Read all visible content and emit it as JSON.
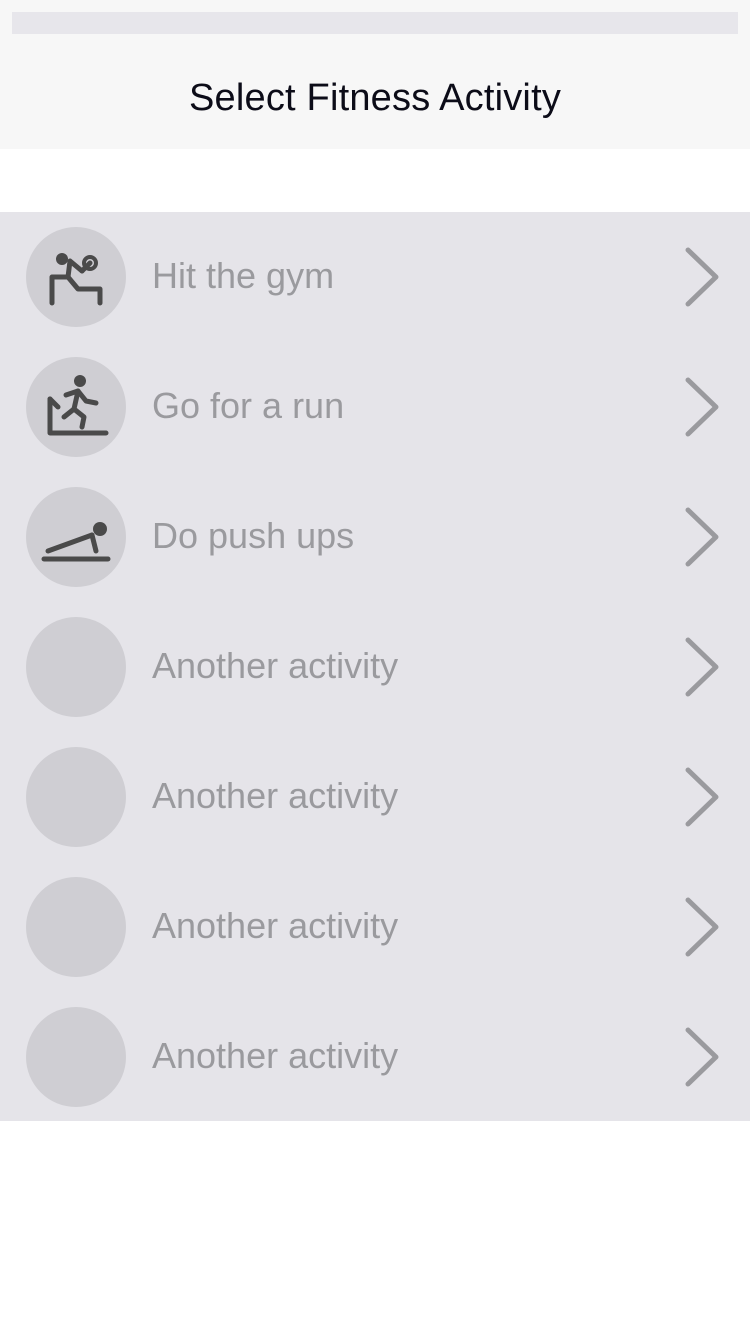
{
  "header": {
    "title": "Select Fitness Activity"
  },
  "colors": {
    "nav_background": "#f7f7f7",
    "list_background": "#e5e4e9",
    "icon_circle": "#cfced3",
    "icon_glyph": "#4a4a4a",
    "label_text": "#9a9a9e",
    "chevron": "#9a9a9e"
  },
  "activities": [
    {
      "label": "Hit the gym",
      "icon": "weightlifting-icon"
    },
    {
      "label": "Go for a run",
      "icon": "treadmill-runner-icon"
    },
    {
      "label": "Do push ups",
      "icon": "push-up-icon"
    },
    {
      "label": "Another activity",
      "icon": ""
    },
    {
      "label": "Another activity",
      "icon": ""
    },
    {
      "label": "Another activity",
      "icon": ""
    },
    {
      "label": "Another activity",
      "icon": ""
    }
  ]
}
